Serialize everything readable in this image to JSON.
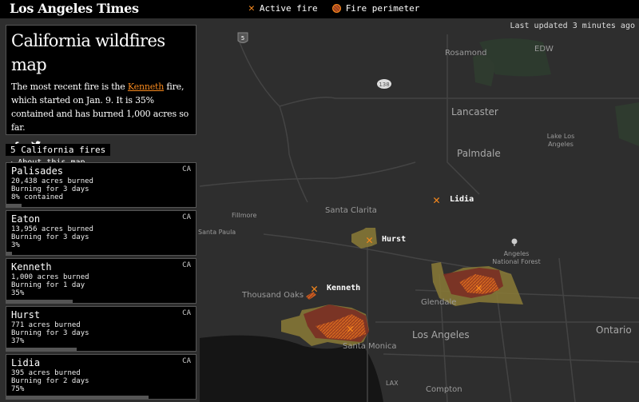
{
  "header": {
    "logo": "Los Angeles Times",
    "legend": [
      {
        "icon": "x-mark-icon",
        "label": "Active fire"
      },
      {
        "icon": "hatched-circle-icon",
        "label": "Fire perimeter"
      }
    ]
  },
  "status": {
    "last_updated": "Last updated 3 minutes ago"
  },
  "intro": {
    "title": "California wildfires map",
    "text_before": "The most recent fire is the ",
    "link": "Kenneth",
    "text_after": " fire, which started on Jan. 9. It is 35% contained and has burned 1,000 acres so far.",
    "social": [
      "f",
      "𝕥"
    ],
    "about": "About this map"
  },
  "fires_count_label": "5 California fires",
  "fires": [
    {
      "name": "Palisades",
      "state": "CA",
      "acres": "20,438 acres burned",
      "burning": "Burning for 3 days",
      "contained": "8% contained",
      "contained_pct": 8
    },
    {
      "name": "Eaton",
      "state": "CA",
      "acres": "13,956 acres burned",
      "burning": "Burning for 3 days",
      "contained": "3%",
      "contained_pct": 3
    },
    {
      "name": "Kenneth",
      "state": "CA",
      "acres": "1,000 acres burned",
      "burning": "Burning for 1 day",
      "contained": "35%",
      "contained_pct": 35
    },
    {
      "name": "Hurst",
      "state": "CA",
      "acres": "771 acres burned",
      "burning": "Burning for 3 days",
      "contained": "37%",
      "contained_pct": 37
    },
    {
      "name": "Lidia",
      "state": "CA",
      "acres": "395 acres burned",
      "burning": "Burning for 2 days",
      "contained": "75%",
      "contained_pct": 75
    }
  ],
  "map": {
    "fire_labels": [
      "Lidia",
      "Hurst",
      "Kenneth"
    ],
    "places": [
      "Rosamond",
      "EDW",
      "Lancaster",
      "Palmdale",
      "Lake Los Angeles",
      "Santa Clarita",
      "Fillmore",
      "Santa Paula",
      "Angeles National Forest",
      "Thousand Oaks",
      "Glendale",
      "Los Angeles",
      "Santa Monica",
      "Ontario",
      "LAX",
      "Compton"
    ],
    "shields": [
      "5",
      "138"
    ]
  },
  "colors": {
    "accent": "#f7891d",
    "perimeter_fill": "#8a3a2a",
    "burn_zone": "#a08a3a"
  }
}
